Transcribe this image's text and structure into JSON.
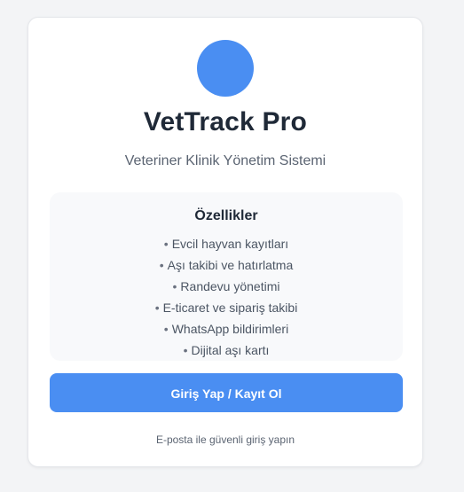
{
  "app": {
    "logo_color": "#4a8ef2",
    "title": "VetTrack Pro",
    "subtitle": "Veteriner Klinik Yönetim Sistemi"
  },
  "features": {
    "heading": "Özellikler",
    "items": [
      "Evcil hayvan kayıtları",
      "Aşı takibi ve hatırlatma",
      "Randevu yönetimi",
      "E-ticaret ve sipariş takibi",
      "WhatsApp bildirimleri",
      "Dijital aşı kartı"
    ]
  },
  "login": {
    "button_label": "Giriş Yap / Kayıt Ol",
    "button_color": "#4a8ef2",
    "note": "E-posta ile güvenli giriş yapın"
  }
}
